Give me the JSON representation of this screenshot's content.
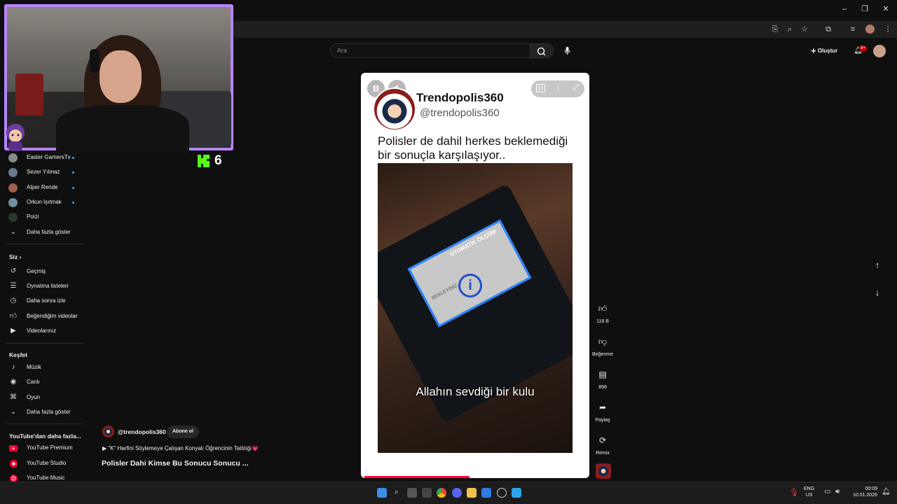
{
  "browser": {
    "window_controls": [
      "minimize-icon",
      "restore-icon",
      "close-icon"
    ],
    "toolbar_icons": [
      "install-icon",
      "zoom-icon",
      "star-icon",
      "extensions-icon",
      "media-icon",
      "profile-avatar",
      "menu-icon"
    ]
  },
  "header": {
    "search_placeholder": "Ara",
    "create_label": "Oluştur",
    "notification_count": "9+"
  },
  "overlay": {
    "kick_viewers": "6"
  },
  "sidebar": {
    "subscriptions": [
      {
        "label": "Easter GamersTv",
        "color": "#8a8a8a"
      },
      {
        "label": "Sezer Yılmaz",
        "color": "#6a7a8a"
      },
      {
        "label": "Alper Rende",
        "color": "#a06050"
      },
      {
        "label": "Orkun Işıtmak",
        "color": "#7090a0"
      },
      {
        "label": "Poizi",
        "color": "#2a3a2a"
      }
    ],
    "show_more_1": "Daha fazla göster",
    "you_heading": "Siz",
    "you_items": [
      {
        "label": "Geçmiş",
        "icon": "history-icon"
      },
      {
        "label": "Oynatma listeleri",
        "icon": "playlist-icon"
      },
      {
        "label": "Daha sonra izle",
        "icon": "clock-icon"
      },
      {
        "label": "Beğendiğim videolar",
        "icon": "like-icon"
      },
      {
        "label": "Videolarınız",
        "icon": "video-icon"
      }
    ],
    "explore_heading": "Keşfet",
    "explore_items": [
      {
        "label": "Müzik",
        "icon": "music-icon"
      },
      {
        "label": "Canlı",
        "icon": "live-icon"
      },
      {
        "label": "Oyun",
        "icon": "gaming-icon"
      }
    ],
    "show_more_2": "Daha fazla göster",
    "more_heading": "YouTube'dan daha fazla...",
    "more_items": [
      {
        "label": "YouTube Premium"
      },
      {
        "label": "YouTube Studio"
      },
      {
        "label": "YouTube Music"
      }
    ]
  },
  "short": {
    "account_name": "Trendopolis360",
    "account_handle": "@trendopolis360",
    "caption": "Polisler de dahil herkes beklemediği bir sonuçla karşılaşıyor..",
    "video_subtitle": "Allahın sevdiği bir kulu",
    "screen_text_1": "OTOMATİK ÖLÇÜM",
    "screen_text_2": "BEKLEYİNİZ",
    "progress": 0.46
  },
  "actions": {
    "like_count": "118 B",
    "dislike_label": "Beğenme",
    "comment_count": "898",
    "share_label": "Paylaş",
    "remix_label": "Remix"
  },
  "channel": {
    "handle": "@trendopolis360",
    "subscribe_label": "Abone ol",
    "sound_line": "\"K\" Harfini Söylemeye Çalışan Konyalı Öğrencinin Tatlılığı💗",
    "title": "Polisler Dahi Kimse Bu Sonucu Sonucu ..."
  },
  "taskbar": {
    "lang_1": "ENG",
    "lang_2": "US",
    "time": "00:09",
    "date": "10.01.2026"
  }
}
